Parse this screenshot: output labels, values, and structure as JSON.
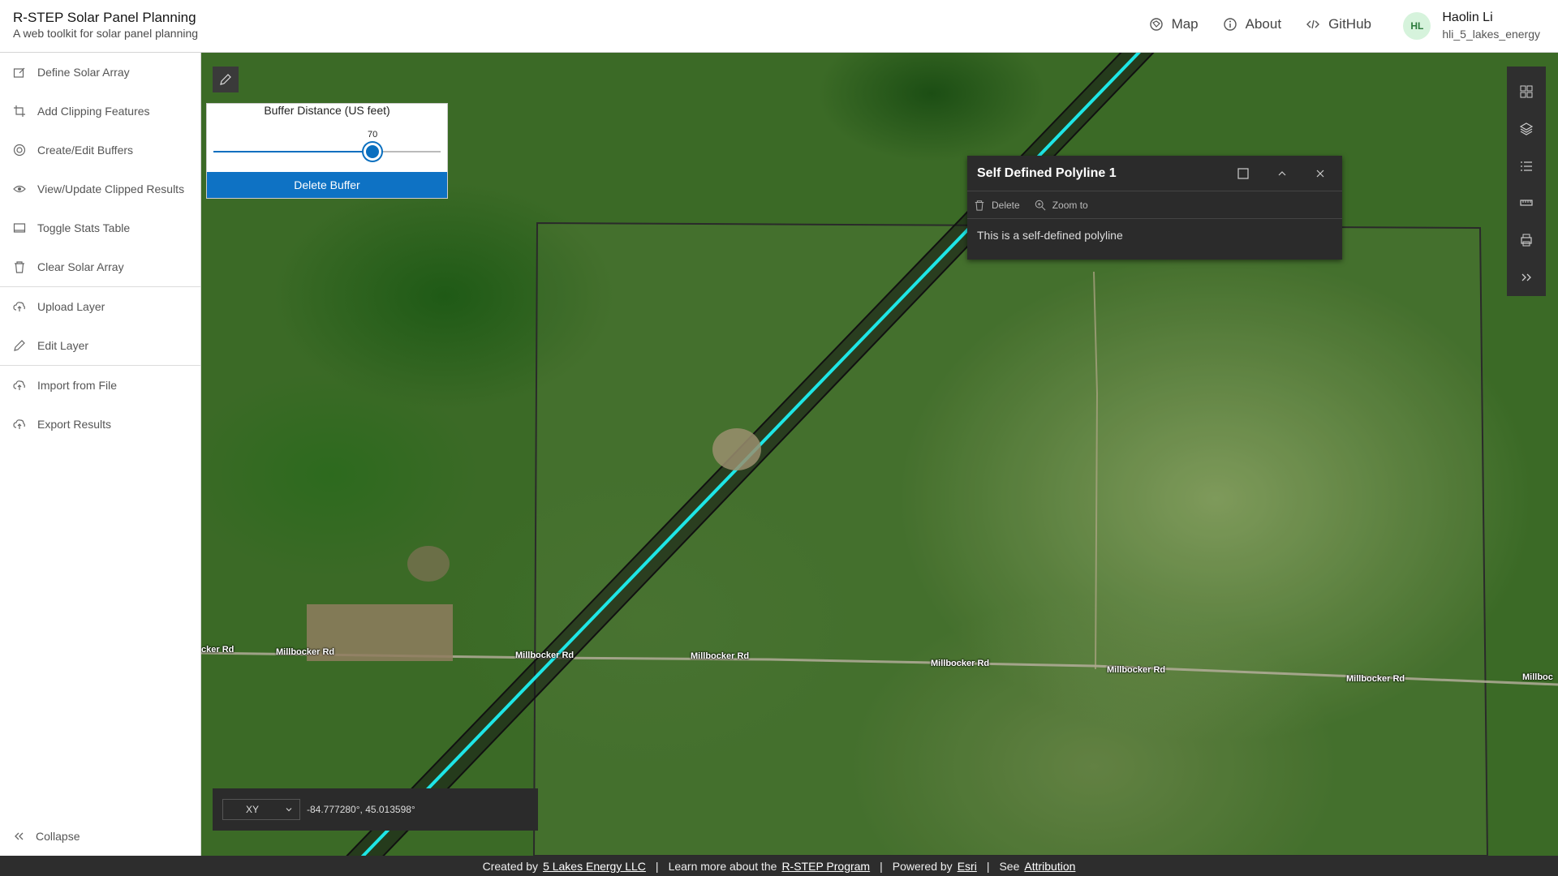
{
  "header": {
    "title": "R-STEP Solar Panel Planning",
    "subtitle": "A web toolkit for solar panel planning",
    "nav": [
      {
        "label": "Map",
        "icon": "map-icon"
      },
      {
        "label": "About",
        "icon": "info-icon"
      },
      {
        "label": "GitHub",
        "icon": "code-icon"
      }
    ],
    "user": {
      "initials": "HL",
      "name": "Haolin Li",
      "id": "hli_5_lakes_energy"
    }
  },
  "sidebar": {
    "groups": [
      [
        {
          "label": "Define Solar Array",
          "icon": "pencil-square-icon"
        },
        {
          "label": "Add Clipping Features",
          "icon": "crop-icon"
        },
        {
          "label": "Create/Edit Buffers",
          "icon": "buffer-icon"
        },
        {
          "label": "View/Update Clipped Results",
          "icon": "eye-icon"
        },
        {
          "label": "Toggle Stats Table",
          "icon": "table-icon"
        },
        {
          "label": "Clear Solar Array",
          "icon": "trash-icon"
        }
      ],
      [
        {
          "label": "Upload Layer",
          "icon": "upload-icon"
        },
        {
          "label": "Edit Layer",
          "icon": "pencil-icon"
        }
      ],
      [
        {
          "label": "Import from File",
          "icon": "import-icon"
        },
        {
          "label": "Export Results",
          "icon": "export-icon"
        }
      ]
    ],
    "collapse_label": "Collapse"
  },
  "buffer": {
    "title": "Buffer Distance (US feet)",
    "value": "70",
    "fraction": 0.7,
    "delete_label": "Delete Buffer"
  },
  "popup": {
    "title": "Self Defined Polyline 1",
    "delete_label": "Delete",
    "zoom_label": "Zoom to",
    "body": "This is a self-defined polyline"
  },
  "map": {
    "road_labels": [
      "cker Rd",
      "Millbocker Rd",
      "Millbocker Rd",
      "Millbocker Rd",
      "Millbocker Rd",
      "Millbocker Rd",
      "Millbocker Rd",
      "Millboc"
    ],
    "polyline_color": "#1ee6e6"
  },
  "coord": {
    "mode": "XY",
    "value": "-84.777280°, 45.013598°"
  },
  "footer": {
    "created_by": "Created by",
    "company": "5 Lakes Energy LLC",
    "learn": "Learn more about the",
    "program": "R-STEP Program",
    "powered": "Powered by",
    "esri": "Esri",
    "see": "See",
    "attribution": "Attribution"
  }
}
